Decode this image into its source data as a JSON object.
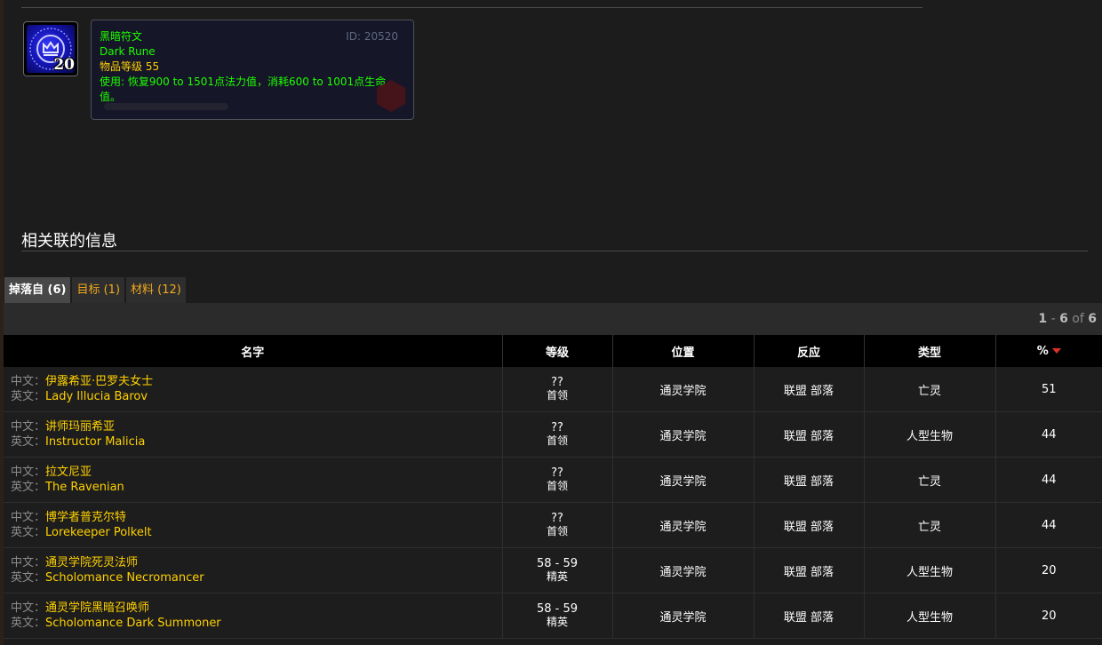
{
  "item": {
    "stack_count": "20",
    "icon": "dark-rune-icon",
    "tooltip": {
      "id_label": "ID: 20520",
      "name_cn": "黑暗符文",
      "name_en": "Dark Rune",
      "item_level": "物品等级 55",
      "use_text": "使用: 恢复900 to 1501点法力值，消耗600 to 1001点生命值。"
    }
  },
  "section": {
    "title": "相关联的信息"
  },
  "tabs": [
    {
      "label": "掉落自 (6)",
      "active": true
    },
    {
      "label": "目标 (1)",
      "active": false
    },
    {
      "label": "材料 (12)",
      "active": false
    }
  ],
  "pager": {
    "from": "1",
    "sep": " - ",
    "to": "6",
    "of": " of ",
    "total": "6"
  },
  "table": {
    "columns": [
      "名字",
      "等级",
      "位置",
      "反应",
      "类型",
      "%"
    ],
    "sort_column": "%",
    "name_prefix_cn": "中文：",
    "name_prefix_en": "英文：",
    "rows": [
      {
        "name_cn": "伊露希亚·巴罗夫女士",
        "name_en": "Lady Illucia Barov",
        "level": "??",
        "level_type": "首领",
        "location": "通灵学院",
        "reaction": "联盟 部落",
        "type": "亡灵",
        "percent": "51"
      },
      {
        "name_cn": "讲师玛丽希亚",
        "name_en": "Instructor Malicia",
        "level": "??",
        "level_type": "首领",
        "location": "通灵学院",
        "reaction": "联盟 部落",
        "type": "人型生物",
        "percent": "44"
      },
      {
        "name_cn": "拉文尼亚",
        "name_en": "The Ravenian",
        "level": "??",
        "level_type": "首领",
        "location": "通灵学院",
        "reaction": "联盟 部落",
        "type": "亡灵",
        "percent": "44"
      },
      {
        "name_cn": "博学者普克尔特",
        "name_en": "Lorekeeper Polkelt",
        "level": "??",
        "level_type": "首领",
        "location": "通灵学院",
        "reaction": "联盟 部落",
        "type": "亡灵",
        "percent": "44"
      },
      {
        "name_cn": "通灵学院死灵法师",
        "name_en": "Scholomance Necromancer",
        "level": "58 - 59",
        "level_type": "精英",
        "location": "通灵学院",
        "reaction": "联盟 部落",
        "type": "人型生物",
        "percent": "20"
      },
      {
        "name_cn": "通灵学院黑暗召唤师",
        "name_en": "Scholomance Dark Summoner",
        "level": "58 - 59",
        "level_type": "精英",
        "location": "通灵学院",
        "reaction": "联盟 部落",
        "type": "人型生物",
        "percent": "20"
      }
    ]
  },
  "colors": {
    "quality_green": "#1eff00",
    "gold_link": "#ffd100",
    "reaction_red": "#ff1a1a",
    "tab_orange": "#f0a81e"
  }
}
